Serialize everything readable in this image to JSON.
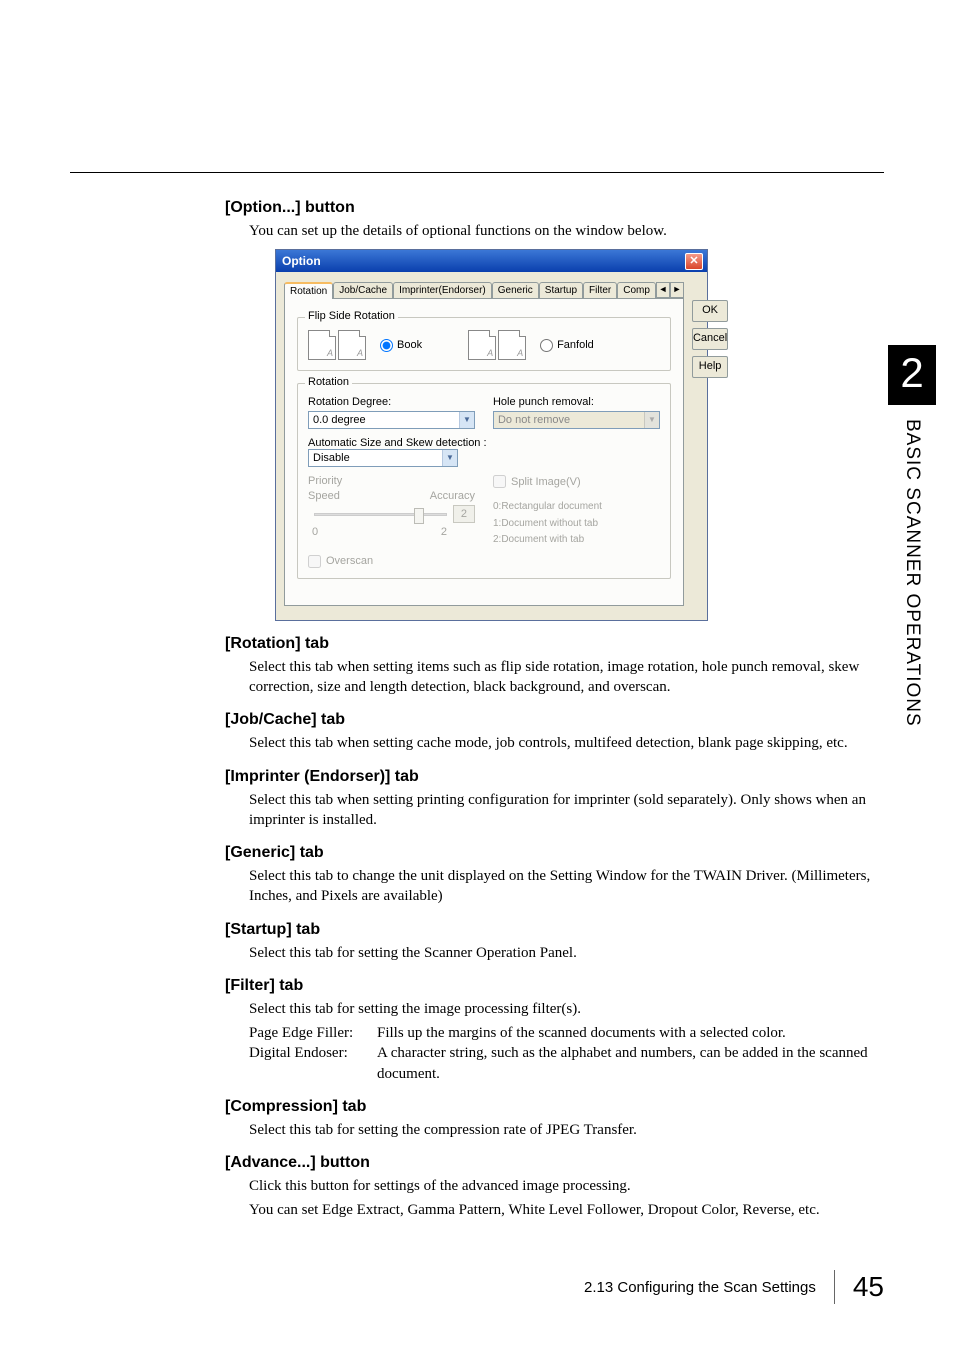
{
  "sidebar": {
    "chapter": "2",
    "label": "BASIC SCANNER OPERATIONS"
  },
  "sections": {
    "option_btn": {
      "head": "[Option...] button",
      "body": "You can set up the details of optional functions on the window below."
    },
    "rotation": {
      "head": "[Rotation] tab",
      "body": "Select this tab when setting items such as flip side rotation, image rotation, hole punch removal, skew correction, size and length detection, black background, and overscan."
    },
    "jobcache": {
      "head": "[Job/Cache] tab",
      "body": "Select this tab when setting cache mode, job controls, multifeed detection, blank page skipping, etc."
    },
    "imprinter": {
      "head": "[Imprinter (Endorser)] tab",
      "body": "Select this tab when setting printing configuration for imprinter (sold separately). Only shows when an imprinter is installed."
    },
    "generic": {
      "head": "[Generic] tab",
      "body": "Select this tab to change the unit displayed on the Setting Window for the TWAIN Driver. (Millimeters, Inches, and Pixels are available)"
    },
    "startup": {
      "head": "[Startup] tab",
      "body": "Select this tab for setting the Scanner Operation Panel."
    },
    "filter": {
      "head": "[Filter] tab",
      "intro": "Select this tab for setting the image processing filter(s).",
      "defs": [
        {
          "term": "Page Edge Filler:",
          "desc": "Fills up the margins of the scanned documents with a selected color."
        },
        {
          "term": "Digital Endoser:",
          "desc": "A character string, such as the alphabet and numbers, can be added in the scanned document."
        }
      ]
    },
    "compression": {
      "head": "[Compression] tab",
      "body": "Select this tab for setting the compression rate of JPEG Transfer."
    },
    "advance": {
      "head": "[Advance...] button",
      "body1": "Click this button for settings of the advanced image processing.",
      "body2": "You can set Edge Extract, Gamma Pattern, White Level Follower, Dropout Color, Reverse, etc."
    }
  },
  "dialog": {
    "title": "Option",
    "tabs": [
      "Rotation",
      "Job/Cache",
      "Imprinter(Endorser)",
      "Generic",
      "Startup",
      "Filter",
      "Comp"
    ],
    "nav": {
      "left": "◄",
      "right": "►"
    },
    "buttons": {
      "ok": "OK",
      "cancel": "Cancel",
      "help": "Help"
    },
    "flip_group": "Flip Side Rotation",
    "flip_book": "Book",
    "flip_fanfold": "Fanfold",
    "rotation_group": "Rotation",
    "rotation_degree_lbl": "Rotation Degree:",
    "rotation_degree_val": "0.0 degree",
    "hole_lbl": "Hole punch removal:",
    "hole_val": "Do not remove",
    "auto_lbl": "Automatic Size and Skew detection :",
    "auto_val": "Disable",
    "priority_lbl": "Priority",
    "speed_lbl": "Speed",
    "accuracy_lbl": "Accuracy",
    "slider_lo": "0",
    "slider_hi": "2",
    "slider_val": "2",
    "split_lbl": "Split Image(V)",
    "helper0": "0:Rectangular document",
    "helper1": "1:Document without tab",
    "helper2": "2:Document with tab",
    "overscan_lbl": "Overscan"
  },
  "footer": {
    "title": "2.13 Configuring the Scan Settings",
    "page": "45"
  }
}
